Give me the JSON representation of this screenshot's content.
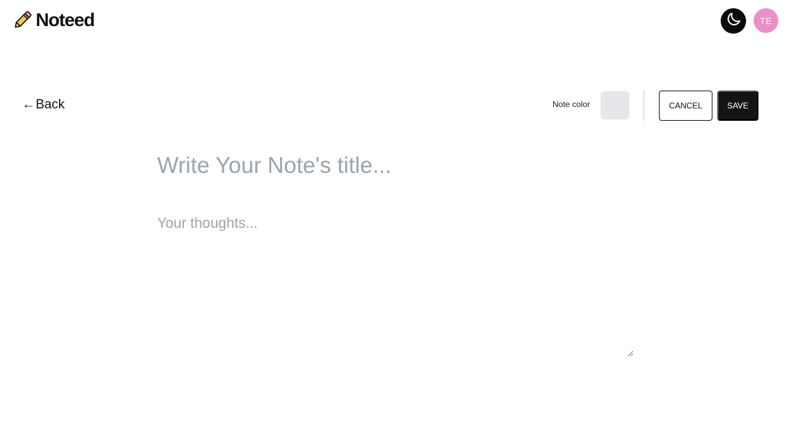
{
  "header": {
    "app_name": "Noteed",
    "logo_icon": "pencil-icon",
    "theme_icon": "moon-icon",
    "avatar_initials": "TE",
    "avatar_color": "#ec8fc8"
  },
  "toolbar": {
    "back_label": "Back",
    "back_icon": "left-arrow-icon",
    "note_color_label": "Note color",
    "note_color_value": "#e5e7eb",
    "cancel_label": "CANCEL",
    "save_label": "SAVE"
  },
  "editor": {
    "title_value": "",
    "title_placeholder": "Write Your Note's title...",
    "body_value": "",
    "body_placeholder": "Your thoughts..."
  }
}
